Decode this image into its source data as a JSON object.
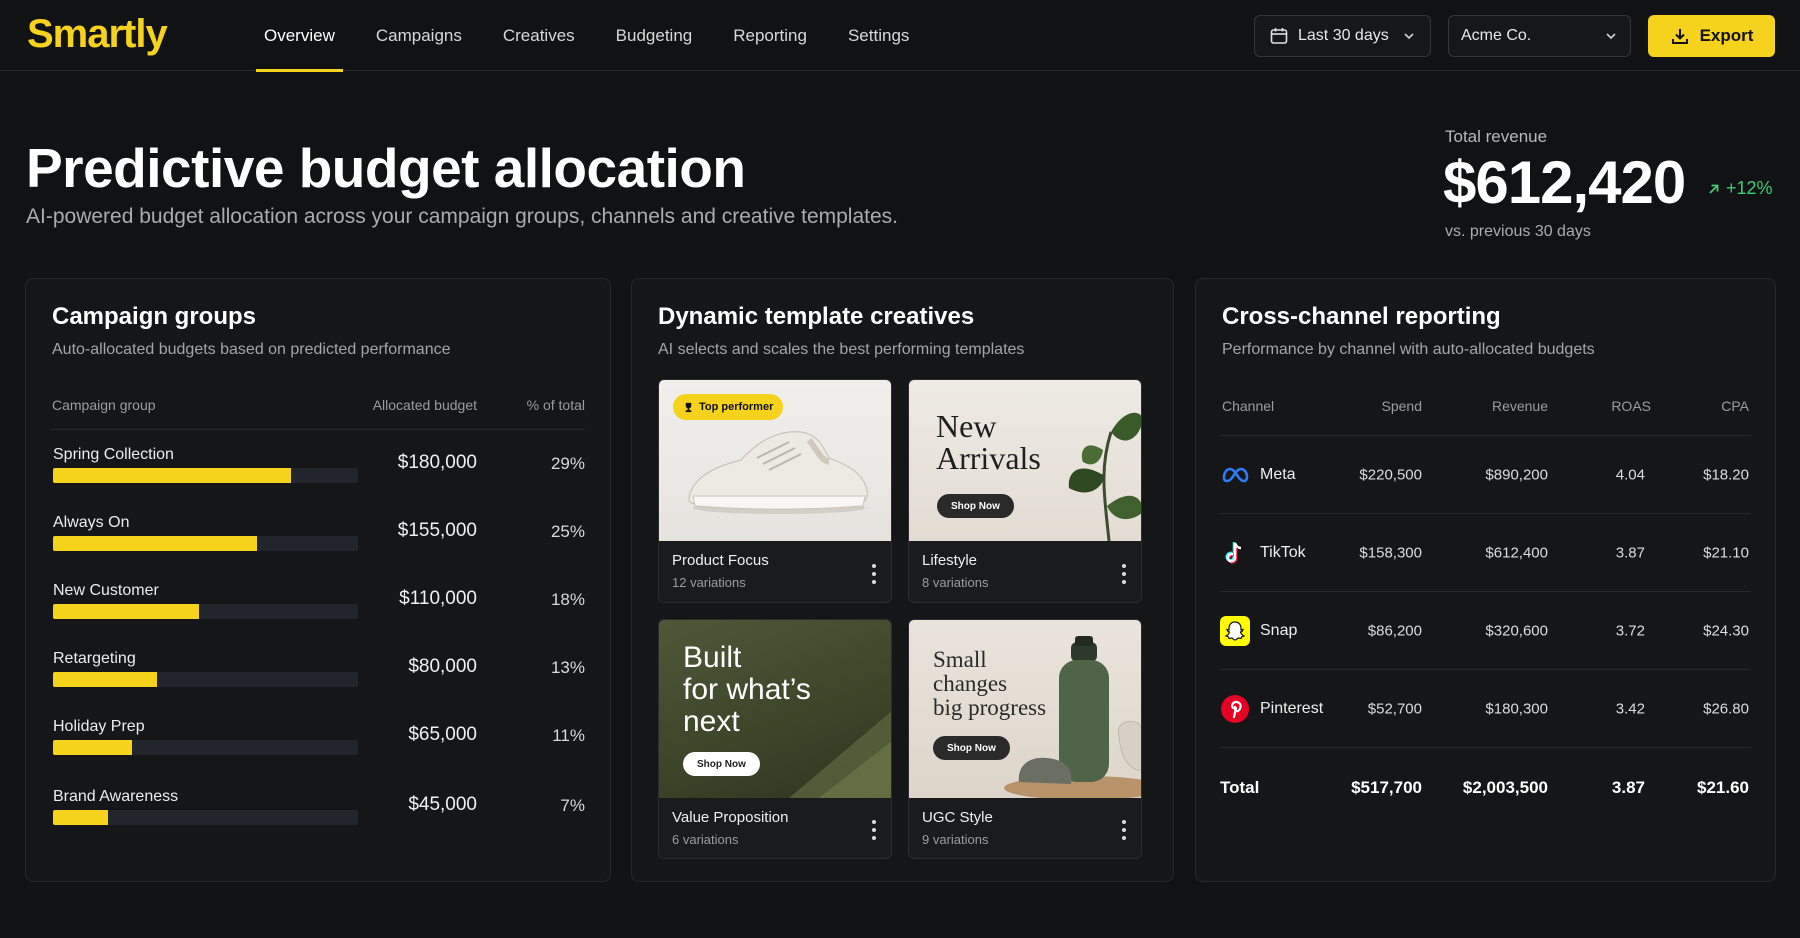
{
  "brand": {
    "logo": "Smartly",
    "accent": "#F5D21C"
  },
  "nav": {
    "tabs": [
      "Overview",
      "Campaigns",
      "Creatives",
      "Budgeting",
      "Reporting",
      "Settings"
    ],
    "active": "Overview",
    "date_range": "Last 30 days",
    "account": "Acme Co.",
    "export_label": "Export"
  },
  "hero": {
    "title": "Predictive budget allocation",
    "subtitle": "AI-powered budget allocation across your campaign groups, channels and creative templates."
  },
  "kpi": {
    "label": "Total revenue",
    "value": "$612,420",
    "change": "+12%",
    "compare": "vs. previous 30 days"
  },
  "campaign_groups": {
    "title": "Campaign groups",
    "subtitle": "Auto-allocated budgets based on predicted performance",
    "headers": {
      "group": "Campaign group",
      "budget": "Allocated budget",
      "pct": "% of total"
    },
    "rows": [
      {
        "name": "Spring Collection",
        "budget": "$180,000",
        "pct": "29%",
        "share": 0.78
      },
      {
        "name": "Always On",
        "budget": "$155,000",
        "pct": "25%",
        "share": 0.67
      },
      {
        "name": "New Customer",
        "budget": "$110,000",
        "pct": "18%",
        "share": 0.48
      },
      {
        "name": "Retargeting",
        "budget": "$80,000",
        "pct": "13%",
        "share": 0.34
      },
      {
        "name": "Holiday Prep",
        "budget": "$65,000",
        "pct": "11%",
        "share": 0.26
      },
      {
        "name": "Brand Awareness",
        "budget": "$45,000",
        "pct": "7%",
        "share": 0.18
      }
    ]
  },
  "creatives": {
    "title": "Dynamic template creatives",
    "subtitle": "AI selects and scales the best performing templates",
    "badge": "Top performer",
    "tiles": [
      {
        "name": "Product Focus",
        "variations": "12 variations"
      },
      {
        "name": "Lifestyle",
        "variations": "8 variations",
        "headline_1": "New",
        "headline_2": "Arrivals",
        "cta": "Shop Now"
      },
      {
        "name": "Value Proposition",
        "variations": "6 variations",
        "headline_1": "Built",
        "headline_2": "for what’s",
        "headline_3": "next",
        "cta": "Shop Now"
      },
      {
        "name": "UGC Style",
        "variations": "9 variations",
        "headline_1": "Small",
        "headline_2": "changes",
        "headline_3": "big progress",
        "cta": "Shop Now"
      }
    ]
  },
  "channels": {
    "title": "Cross-channel reporting",
    "subtitle": "Performance by channel with auto-allocated budgets",
    "headers": {
      "channel": "Channel",
      "spend": "Spend",
      "revenue": "Revenue",
      "roas": "ROAS",
      "cpa": "CPA"
    },
    "rows": [
      {
        "name": "Meta",
        "icon": "meta-icon",
        "spend": "$220,500",
        "revenue": "$890,200",
        "roas": "4.04",
        "cpa": "$18.20"
      },
      {
        "name": "TikTok",
        "icon": "tiktok-icon",
        "spend": "$158,300",
        "revenue": "$612,400",
        "roas": "3.87",
        "cpa": "$21.10"
      },
      {
        "name": "Snap",
        "icon": "snapchat-icon",
        "spend": "$86,200",
        "revenue": "$320,600",
        "roas": "3.72",
        "cpa": "$24.30"
      },
      {
        "name": "Pinterest",
        "icon": "pinterest-icon",
        "spend": "$52,700",
        "revenue": "$180,300",
        "roas": "3.42",
        "cpa": "$26.80"
      }
    ],
    "total": {
      "name": "Total",
      "spend": "$517,700",
      "revenue": "$2,003,500",
      "roas": "3.87",
      "cpa": "$21.60"
    }
  },
  "colors": {
    "positive": "#3FCB7A",
    "background": "#111213",
    "card": "#151617"
  }
}
